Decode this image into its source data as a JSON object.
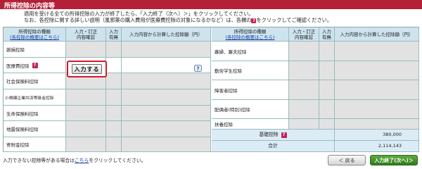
{
  "title": "所得控除の内容等",
  "intro": {
    "line1": "適用を受ける全ての所得控除の入力が終了したら、「入力終了（次へ）＞」をクリックしてください。",
    "line2_pre": "なお、各控除に関する詳しい説明（風邪薬の購入費用が医療費控除の対象になるかなど）は、各欄の",
    "line2_post": "をクリックしてご確認ください。",
    "q_icon": "?"
  },
  "header": {
    "type_label": "所得控除の種類",
    "type_link": "(各控除の概要はこちら)",
    "input_label": "入力・訂正\n内容確認",
    "has_label": "入力\n有無",
    "amount_label": "入力内容から計算した控除額（円）"
  },
  "left_rows": [
    {
      "label": "雑損控除",
      "help": false
    },
    {
      "label": "医療費控除",
      "help": true
    },
    {
      "label": "社会保険料控除",
      "help": false
    },
    {
      "label": "小規模企業共済等掛金控除",
      "help": false
    },
    {
      "label": "生命保険料控除",
      "help": false
    },
    {
      "label": "地震保険料控除",
      "help": false
    },
    {
      "label": "寄附金控除",
      "help": false
    }
  ],
  "right_rows": [
    {
      "label": "寡婦、寡夫控除"
    },
    {
      "label": "勤労学生控除"
    },
    {
      "label": "障害者控除"
    },
    {
      "label": "配偶者(特別)控除"
    },
    {
      "label": "扶養控除"
    }
  ],
  "basic": {
    "label": "基礎控除",
    "amount": "380,000"
  },
  "total": {
    "label": "合計",
    "amount": "2,114,143"
  },
  "input_button": "入力する",
  "footer": {
    "pre": "入力できない控除等がある場合は",
    "link": "こちら",
    "post": "をクリックしてください。"
  },
  "buttons": {
    "back": "＜ 戻る",
    "next": "入力終了(次へ)＞"
  },
  "colors": {
    "title_bar": "#b42037",
    "header": "#cde3ee",
    "next_button": "#3f8f2a",
    "highlight": "#d4192c"
  }
}
